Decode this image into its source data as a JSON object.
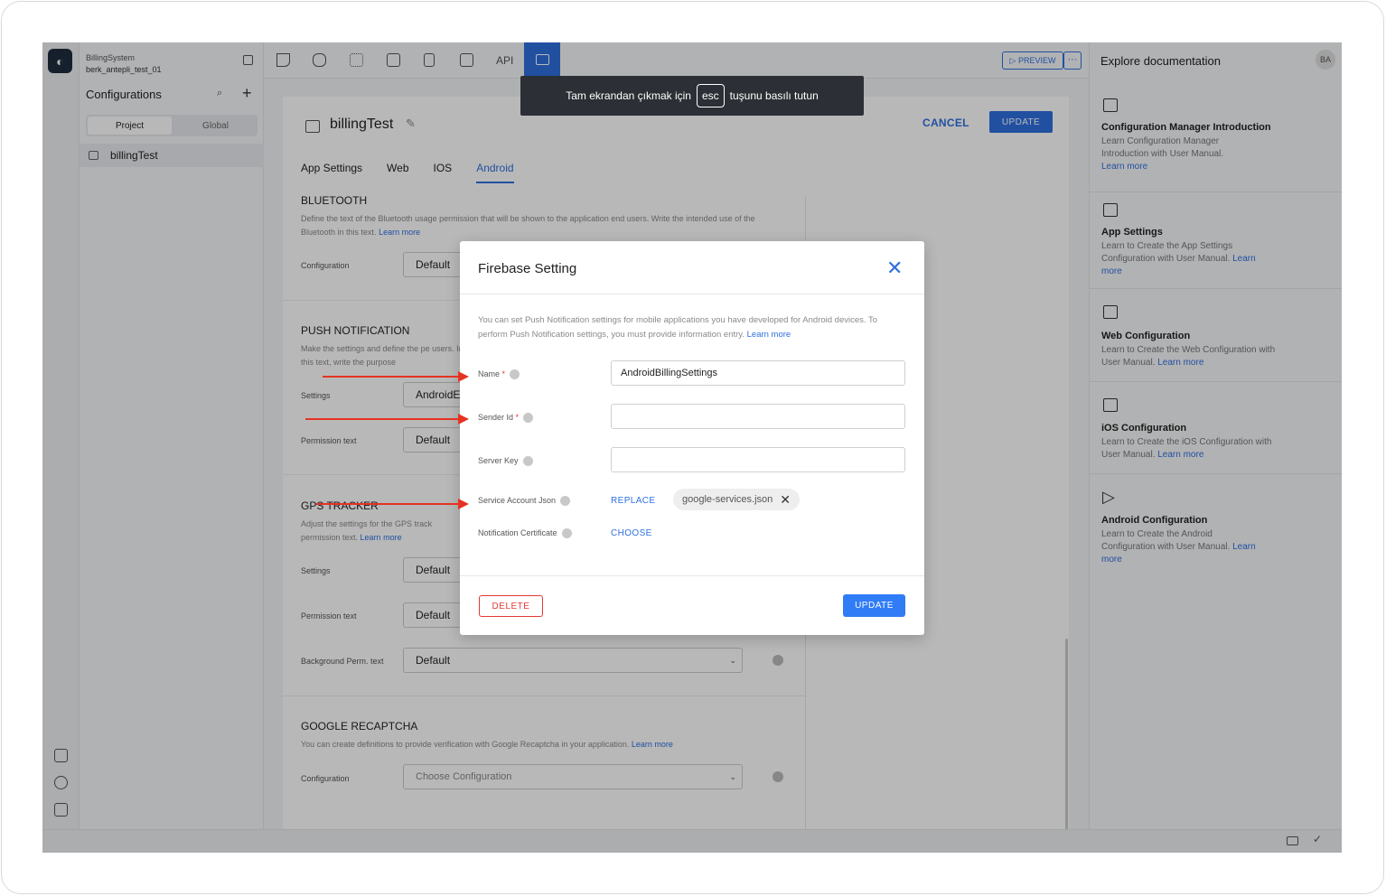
{
  "project": {
    "name": "BillingSystem",
    "user": "berk_antepli_test_01"
  },
  "sidebar": {
    "title": "Configurations",
    "segments": [
      "Project",
      "Global"
    ],
    "items": [
      "billingTest"
    ]
  },
  "toolbar": {
    "api_label": "API",
    "preview_label": "▷ PREVIEW",
    "more_label": "···"
  },
  "toast": {
    "before": "Tam ekrandan çıkmak için",
    "key": "esc",
    "after": "tuşunu basılı tutun"
  },
  "page": {
    "title": "billingTest",
    "cancel": "CANCEL",
    "update": "UPDATE",
    "tabs": [
      "App Settings",
      "Web",
      "IOS",
      "Android"
    ],
    "sections": {
      "bluetooth": {
        "title": "BLUETOOTH",
        "desc": "Define the text of the Bluetooth usage permission that will be shown to the application end users. Write the intended use of the Bluetooth in this text.",
        "learn": "Learn more",
        "config_label": "Configuration",
        "config_value": "Default"
      },
      "push": {
        "title": "PUSH NOTIFICATION",
        "desc": "Make the settings and define the pe users. In this text, write the purpose",
        "settings_label": "Settings",
        "settings_value": "AndroidE",
        "perm_label": "Permission text",
        "perm_value": "Default"
      },
      "gps": {
        "title": "GPS TRACKER",
        "desc": "Adjust the settings for the GPS track permission text.",
        "learn": "Learn more",
        "settings_label": "Settings",
        "settings_value": "Default",
        "perm_label": "Permission text",
        "perm_value": "Default",
        "bg_label": "Background Perm. text",
        "bg_value": "Default"
      },
      "recaptcha": {
        "title": "GOOGLE RECAPTCHA",
        "desc": "You can create definitions to provide verification with Google Recaptcha in your application.",
        "learn": "Learn more",
        "config_label": "Configuration",
        "config_placeholder": "Choose Configuration"
      }
    }
  },
  "docs": {
    "title": "Explore documentation",
    "avatar": "BA",
    "items": [
      {
        "title": "Configuration Manager Introduction",
        "desc": "Learn Configuration Manager Introduction with User Manual.",
        "learn": "Learn more"
      },
      {
        "title": "App Settings",
        "desc": "Learn to Create the App Settings Configuration with User Manual.",
        "learn": "Learn more"
      },
      {
        "title": "Web Configuration",
        "desc": "Learn to Create the Web Configuration with User Manual.",
        "learn": "Learn more"
      },
      {
        "title": "iOS Configuration",
        "desc": "Learn to Create the iOS Configuration with User Manual.",
        "learn": "Learn more"
      },
      {
        "title": "Android Configuration",
        "desc": "Learn to Create the Android Configuration with User Manual.",
        "learn": "Learn more"
      }
    ]
  },
  "modal": {
    "title": "Firebase Setting",
    "desc": "You can set Push Notification settings for mobile applications you have developed for Android devices. To perform Push Notification settings, you must provide information entry.",
    "learn": "Learn more",
    "fields": {
      "name_label": "Name",
      "name_value": "AndroidBillingSettings",
      "sender_label": "Sender Id",
      "sender_value": "",
      "server_label": "Server Key",
      "server_value": "",
      "json_label": "Service Account Json",
      "json_action": "REPLACE",
      "json_file": "google-services.json",
      "cert_label": "Notification Certificate",
      "cert_action": "CHOOSE"
    },
    "delete": "DELETE",
    "update": "UPDATE"
  },
  "colors": {
    "accent": "#2f6fe0",
    "danger": "#e53935",
    "annotation": "#e53322"
  }
}
